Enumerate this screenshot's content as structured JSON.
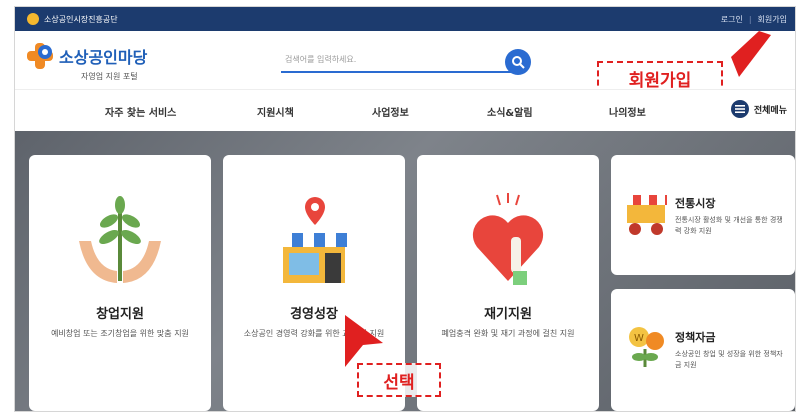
{
  "topbar": {
    "brand": "소상공인시장진흥공단",
    "login": "로그인",
    "join": "회원가입"
  },
  "header": {
    "logo_title": "소상공인마당",
    "logo_subtitle": "자영업 지원 포털",
    "search_placeholder": "검색어를 입력하세요."
  },
  "nav": {
    "items": [
      "자주 찾는 서비스",
      "지원시책",
      "사업정보",
      "소식&알림",
      "나의정보"
    ],
    "all_menu": "전체메뉴"
  },
  "cards": [
    {
      "title": "창업지원",
      "desc": "예비창업 또는 조기창업을 위한 맞춤 지원"
    },
    {
      "title": "경영성장",
      "desc": "소상공인 경영력 강화를 위한 교육 및 지원"
    },
    {
      "title": "재기지원",
      "desc": "폐업충격 완화 및 재기 과정에 걸친 지원"
    }
  ],
  "side_cards": [
    {
      "title": "전통시장",
      "desc": "전통시장 활성화 및 개선을 통한 경쟁력 강화 지원"
    },
    {
      "title": "정책자금",
      "desc": "소상공인 창업 및 성장을 위한 정책자금 지원"
    }
  ],
  "annotations": {
    "join_callout": "회원가입",
    "select_callout": "선택"
  },
  "colors": {
    "navy": "#1c3b6e",
    "blue": "#2a6bd1",
    "red": "#e02020"
  }
}
